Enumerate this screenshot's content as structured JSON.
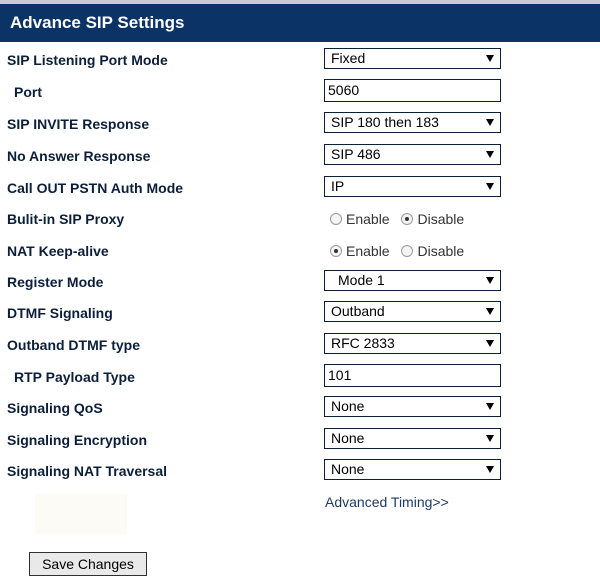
{
  "header": {
    "title": "Advance SIP Settings"
  },
  "rows": {
    "listening_port_mode": {
      "label": "SIP Listening Port Mode",
      "value": "Fixed"
    },
    "port": {
      "label": "Port",
      "value": "5060"
    },
    "invite_response": {
      "label": "SIP INVITE Response",
      "value": "SIP 180 then 183"
    },
    "no_answer_response": {
      "label": "No Answer Response",
      "value": "SIP 486"
    },
    "callout_auth_mode": {
      "label": "Call OUT PSTN Auth Mode",
      "value": "IP"
    },
    "builtin_proxy": {
      "label": "Bulit-in SIP Proxy",
      "opt1": "Enable",
      "opt2": "Disable",
      "selected": "Disable"
    },
    "nat_keepalive": {
      "label": "NAT Keep-alive",
      "opt1": "Enable",
      "opt2": "Disable",
      "selected": "Enable"
    },
    "register_mode": {
      "label": "Register Mode",
      "value": "Mode 1"
    },
    "dtmf_signaling": {
      "label": "DTMF Signaling",
      "value": "Outband"
    },
    "outband_dtmf_type": {
      "label": "Outband DTMF type",
      "value": "RFC 2833"
    },
    "rtp_payload_type": {
      "label": "RTP Payload Type",
      "value": "101"
    },
    "signaling_qos": {
      "label": "Signaling QoS",
      "value": "None"
    },
    "signaling_encryption": {
      "label": "Signaling Encryption",
      "value": "None"
    },
    "signaling_nat_traversal": {
      "label": "Signaling NAT Traversal",
      "value": "None"
    }
  },
  "advanced_timing_link": "Advanced Timing>>",
  "save_button": "Save Changes",
  "colors": {
    "header_bg": "#0b3366",
    "label_text": "#0b1f3a"
  }
}
